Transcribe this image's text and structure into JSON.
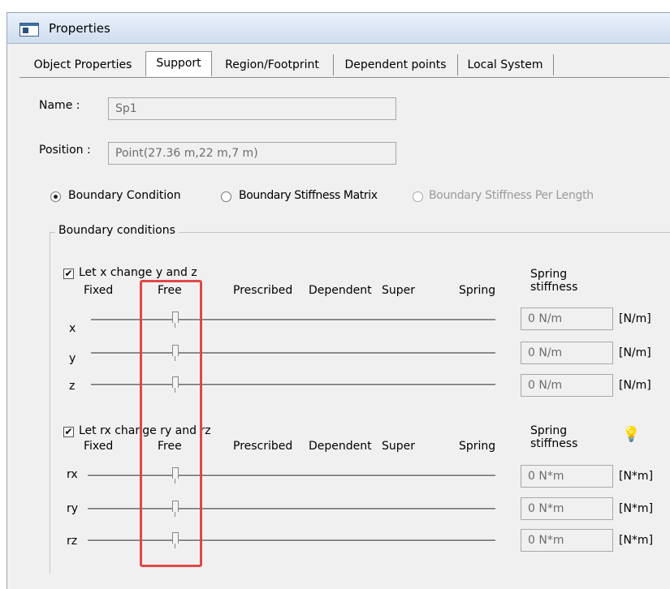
{
  "window": {
    "title": "Properties",
    "icon": "properties-window-icon"
  },
  "tabs": [
    "Object Properties",
    "Support",
    "Region/Footprint",
    "Dependent points",
    "Local System"
  ],
  "active_tab": "Support",
  "name": {
    "label": "Name :",
    "value": "Sp1"
  },
  "position": {
    "label": "Position :",
    "value": "Point(27.36 m,22 m,7 m)"
  },
  "mode_options": [
    "Boundary Condition",
    "Boundary Stiffness Matrix",
    "Boundary Stiffness Per Length"
  ],
  "mode_selected": "Boundary Condition",
  "group_title": "Boundary conditions",
  "translation": {
    "checkbox_label": "Let x change y and z",
    "checked": true,
    "headers": [
      "Fixed",
      "Free",
      "Prescribed",
      "Dependent",
      "Super",
      "Spring"
    ],
    "stiffness_header": [
      "Spring",
      "stiffness"
    ],
    "rows": [
      {
        "axis": "x",
        "state": "Free",
        "stiffness": "0 N/m",
        "unit": "[N/m]"
      },
      {
        "axis": "y",
        "state": "Free",
        "stiffness": "0 N/m",
        "unit": "[N/m]"
      },
      {
        "axis": "z",
        "state": "Free",
        "stiffness": "0 N/m",
        "unit": "[N/m]"
      }
    ]
  },
  "rotation": {
    "checkbox_label": "Let rx change ry and rz",
    "checked": true,
    "headers": [
      "Fixed",
      "Free",
      "Prescribed",
      "Dependent",
      "Super",
      "Spring"
    ],
    "stiffness_header": [
      "Spring",
      "stiffness"
    ],
    "help_icon": "hint-bulb-icon",
    "rows": [
      {
        "axis": "rx",
        "state": "Free",
        "stiffness": "0 N*m",
        "unit": "[N*m]"
      },
      {
        "axis": "ry",
        "state": "Free",
        "stiffness": "0 N*m",
        "unit": "[N*m]"
      },
      {
        "axis": "rz",
        "state": "Free",
        "stiffness": "0 N*m",
        "unit": "[N*m]"
      }
    ]
  },
  "colors": {
    "highlight": "#e04848",
    "title_bar": "#cfddee",
    "window_bg": "#f0f0f0"
  }
}
